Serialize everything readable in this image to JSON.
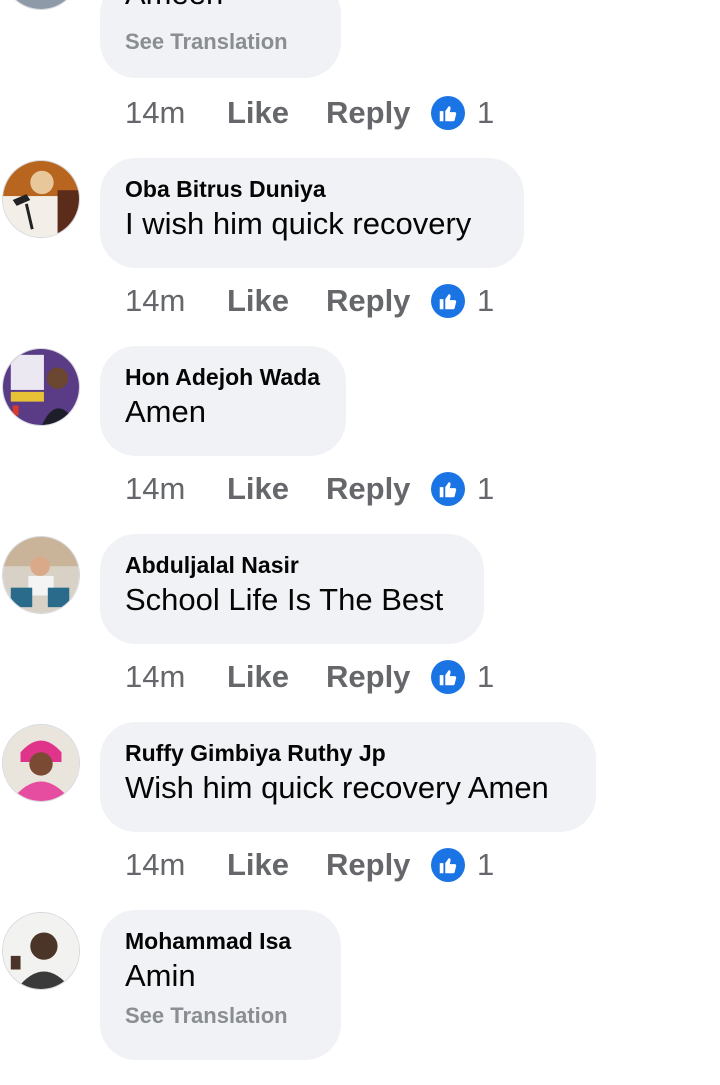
{
  "comments": [
    {
      "author": "",
      "text": "Ameen",
      "see_translation": "See Translation",
      "time": "14m",
      "like_label": "Like",
      "reply_label": "Reply",
      "reaction_count": "1"
    },
    {
      "author": "Oba Bitrus Duniya",
      "text": "I wish him quick recovery",
      "time": "14m",
      "like_label": "Like",
      "reply_label": "Reply",
      "reaction_count": "1"
    },
    {
      "author": "Hon Adejoh Wada",
      "text": "Amen",
      "time": "14m",
      "like_label": "Like",
      "reply_label": "Reply",
      "reaction_count": "1"
    },
    {
      "author": "Abduljalal Nasir",
      "text": "School Life Is The Best",
      "time": "14m",
      "like_label": "Like",
      "reply_label": "Reply",
      "reaction_count": "1"
    },
    {
      "author": "Ruffy Gimbiya Ruthy Jp",
      "text": "Wish him quick recovery Amen",
      "time": "14m",
      "like_label": "Like",
      "reply_label": "Reply",
      "reaction_count": "1"
    },
    {
      "author": "Mohammad Isa",
      "text": "Amin",
      "see_translation": "See Translation",
      "time": "",
      "like_label": "",
      "reply_label": "",
      "reaction_count": ""
    }
  ],
  "icons": {
    "reaction": "like-thumb-icon"
  },
  "colors": {
    "bubble_bg": "#f0f2f5",
    "reaction_blue": "#1b74e4",
    "meta_gray": "#65676b",
    "translation_gray": "#8a8d91"
  }
}
